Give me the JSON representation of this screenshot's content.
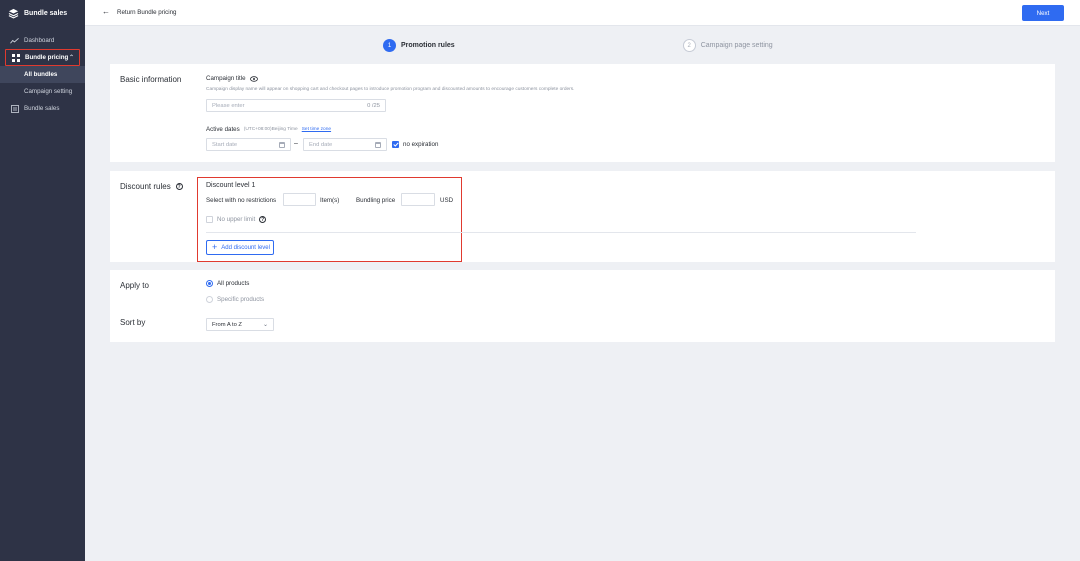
{
  "sidebar": {
    "brand": "Bundle sales",
    "items": [
      {
        "label": "Dashboard"
      },
      {
        "label": "Bundle pricing"
      },
      {
        "label": "All bundles"
      },
      {
        "label": "Campaign setting"
      },
      {
        "label": "Bundle sales"
      }
    ]
  },
  "topbar": {
    "back_label": "Return Bundle pricing",
    "next_label": "Next"
  },
  "steps": [
    {
      "num": "1",
      "label": "Promotion rules"
    },
    {
      "num": "2",
      "label": "Campaign page setting"
    }
  ],
  "basic": {
    "title": "Basic information",
    "campaign_title_label": "Campaign title",
    "campaign_title_hint": "Campaign display name will appear on shopping cart and checkout pages to introduce promotion program and discounted amounts to encourage customers complete orders.",
    "campaign_title_placeholder": "Please enter",
    "campaign_title_counter": "0 /25",
    "active_dates_label": "Active dates",
    "timezone_note": "(UTC+08:00)Beijing Time",
    "set_timezone_link": "Set time zone",
    "start_date_placeholder": "Start date",
    "date_separator": "–",
    "end_date_placeholder": "End date",
    "no_expiration_label": "no expiration"
  },
  "discount": {
    "title": "Discount rules",
    "level_title": "Discount level 1",
    "select_label": "Select with no restrictions",
    "items_unit": "Item(s)",
    "bundling_price_label": "Bundling price",
    "currency": "USD",
    "no_upper_limit_label": "No upper limit",
    "add_level_label": "Add discount level"
  },
  "apply": {
    "title": "Apply to",
    "options": [
      {
        "label": "All products"
      },
      {
        "label": "Specific products"
      }
    ],
    "sort_title": "Sort by",
    "sort_value": "From A to Z"
  },
  "colors": {
    "primary": "#2f6bf1",
    "sidebar_bg": "#2e3346",
    "highlight": "#e03a2f"
  }
}
